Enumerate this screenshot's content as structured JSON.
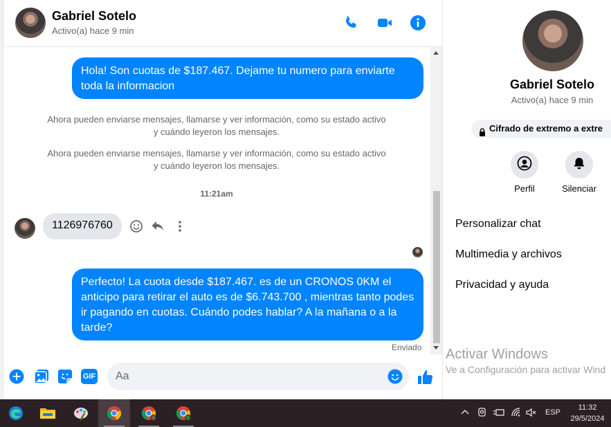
{
  "header": {
    "contact_name": "Gabriel Sotelo",
    "status": "Activo(a) hace 9 min",
    "icons": [
      "phone-icon",
      "video-camera-icon",
      "info-icon"
    ]
  },
  "messages": {
    "outgoing_1": "Hola! Son cuotas de $187.467. Dejame tu numero para enviarte toda la informacion",
    "system_1": "Ahora pueden enviarse mensajes, llamarse y ver información, como su estado activo y cuándo leyeron los mensajes.",
    "system_2": "Ahora pueden enviarse mensajes, llamarse y ver información, como su estado activo y cuándo leyeron los mensajes.",
    "time_separator": "11:21am",
    "incoming_1": "1126976760",
    "outgoing_2": "Perfecto! La cuota desde $187.467. es de un CRONOS 0KM el anticipo para retirar el auto es de $6.743.700 , mientras tanto podes ir pagando en cuotas. Cuándo podes hablar? A la mañana o a la tarde?",
    "delivery_status": "Enviado"
  },
  "composer": {
    "placeholder": "Aa",
    "icons": [
      "plus-circle-icon",
      "image-icon",
      "sticker-icon",
      "gif-icon",
      "emoji-icon",
      "thumbs-up-icon"
    ],
    "gif_label": "GIF"
  },
  "profile": {
    "name": "Gabriel Sotelo",
    "status": "Activo(a) hace 9 min",
    "encryption": "Cifrado de extremo a extre",
    "actions": [
      {
        "label": "Perfil",
        "icon": "profile-icon"
      },
      {
        "label": "Silenciar",
        "icon": "bell-icon"
      }
    ],
    "menu": [
      "Personalizar chat",
      "Multimedia y archivos",
      "Privacidad y ayuda"
    ]
  },
  "watermark": {
    "title": "Activar Windows",
    "subtitle": "Ve a Configuración para activar Wind"
  },
  "taskbar": {
    "apps": [
      "windows-edge-icon",
      "file-explorer-icon",
      "paint-icon",
      "chrome-icon",
      "chrome-profile-icon",
      "chrome-profile-t-icon"
    ],
    "language": "ESP",
    "time": "11:32",
    "date": "29/5/2024"
  },
  "colors": {
    "accent": "#0084ff",
    "incoming_bubble": "#e4e6eb",
    "taskbar": "#2b2125"
  }
}
